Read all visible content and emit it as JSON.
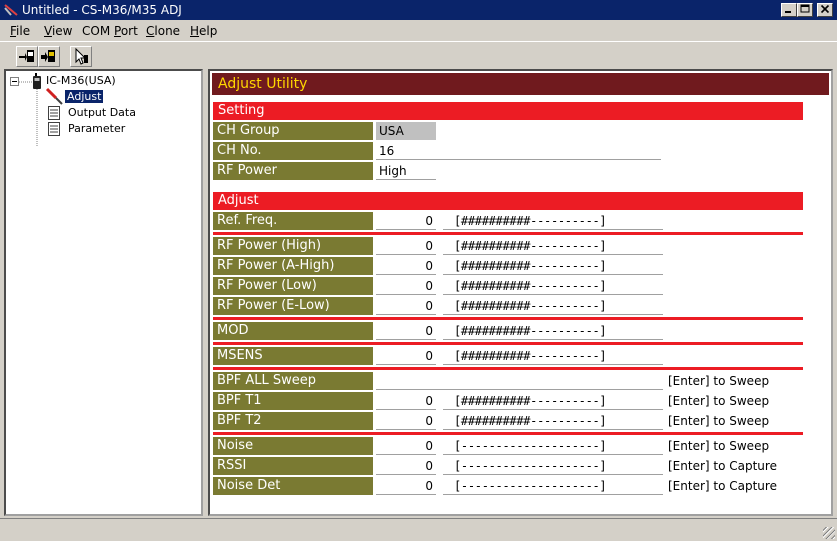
{
  "window": {
    "title": "Untitled - CS-M36/M35 ADJ"
  },
  "menu": [
    {
      "label": "File",
      "key": "F",
      "rest": "ile"
    },
    {
      "label": "View",
      "key": "V",
      "rest": "iew"
    },
    {
      "label": "COM Port",
      "pre": "COM ",
      "key": "P",
      "rest": "ort"
    },
    {
      "label": "Clone",
      "key": "C",
      "rest": "lone"
    },
    {
      "label": "Help",
      "key": "H",
      "rest": "elp"
    }
  ],
  "tree": {
    "root": "IC-M36(USA)",
    "items": [
      "Adjust",
      "Output Data",
      "Parameter"
    ]
  },
  "panel": {
    "title": "Adjust Utility"
  },
  "setting": {
    "header": "Setting",
    "rows": [
      {
        "label": "CH Group",
        "value": "USA"
      },
      {
        "label": "CH No.",
        "value": "16"
      },
      {
        "label": "RF Power",
        "value": "High"
      }
    ]
  },
  "adjust": {
    "header": "Adjust",
    "rows": [
      {
        "label": "Ref. Freq.",
        "value": "0",
        "bar": "[##########----------]",
        "action": ""
      },
      {
        "label": "RF Power (High)",
        "value": "0",
        "bar": "[##########----------]",
        "action": ""
      },
      {
        "label": "RF Power (A-High)",
        "value": "0",
        "bar": "[##########----------]",
        "action": ""
      },
      {
        "label": "RF Power (Low)",
        "value": "0",
        "bar": "[##########----------]",
        "action": ""
      },
      {
        "label": "RF Power (E-Low)",
        "value": "0",
        "bar": "[##########----------]",
        "action": ""
      },
      {
        "label": "MOD",
        "value": "0",
        "bar": "[##########----------]",
        "action": ""
      },
      {
        "label": "MSENS",
        "value": "0",
        "bar": "[##########----------]",
        "action": ""
      },
      {
        "label": "BPF ALL Sweep",
        "value": "",
        "bar": "",
        "action": "[Enter] to Sweep"
      },
      {
        "label": "BPF T1",
        "value": "0",
        "bar": "[##########----------]",
        "action": "[Enter] to Sweep"
      },
      {
        "label": "BPF T2",
        "value": "0",
        "bar": "[##########----------]",
        "action": "[Enter] to Sweep"
      },
      {
        "label": "Noise",
        "value": "0",
        "bar": "[--------------------]",
        "action": "[Enter] to Sweep"
      },
      {
        "label": "RSSI",
        "value": "0",
        "bar": "[--------------------]",
        "action": "[Enter] to Capture"
      },
      {
        "label": "Noise Det",
        "value": "0",
        "bar": "[--------------------]",
        "action": "[Enter] to Capture"
      }
    ]
  },
  "colors": {
    "title_bar": "#0a246a",
    "panel_header": "#701a1e",
    "section_header": "#ec1c24",
    "label_bg": "#7a7a32"
  }
}
